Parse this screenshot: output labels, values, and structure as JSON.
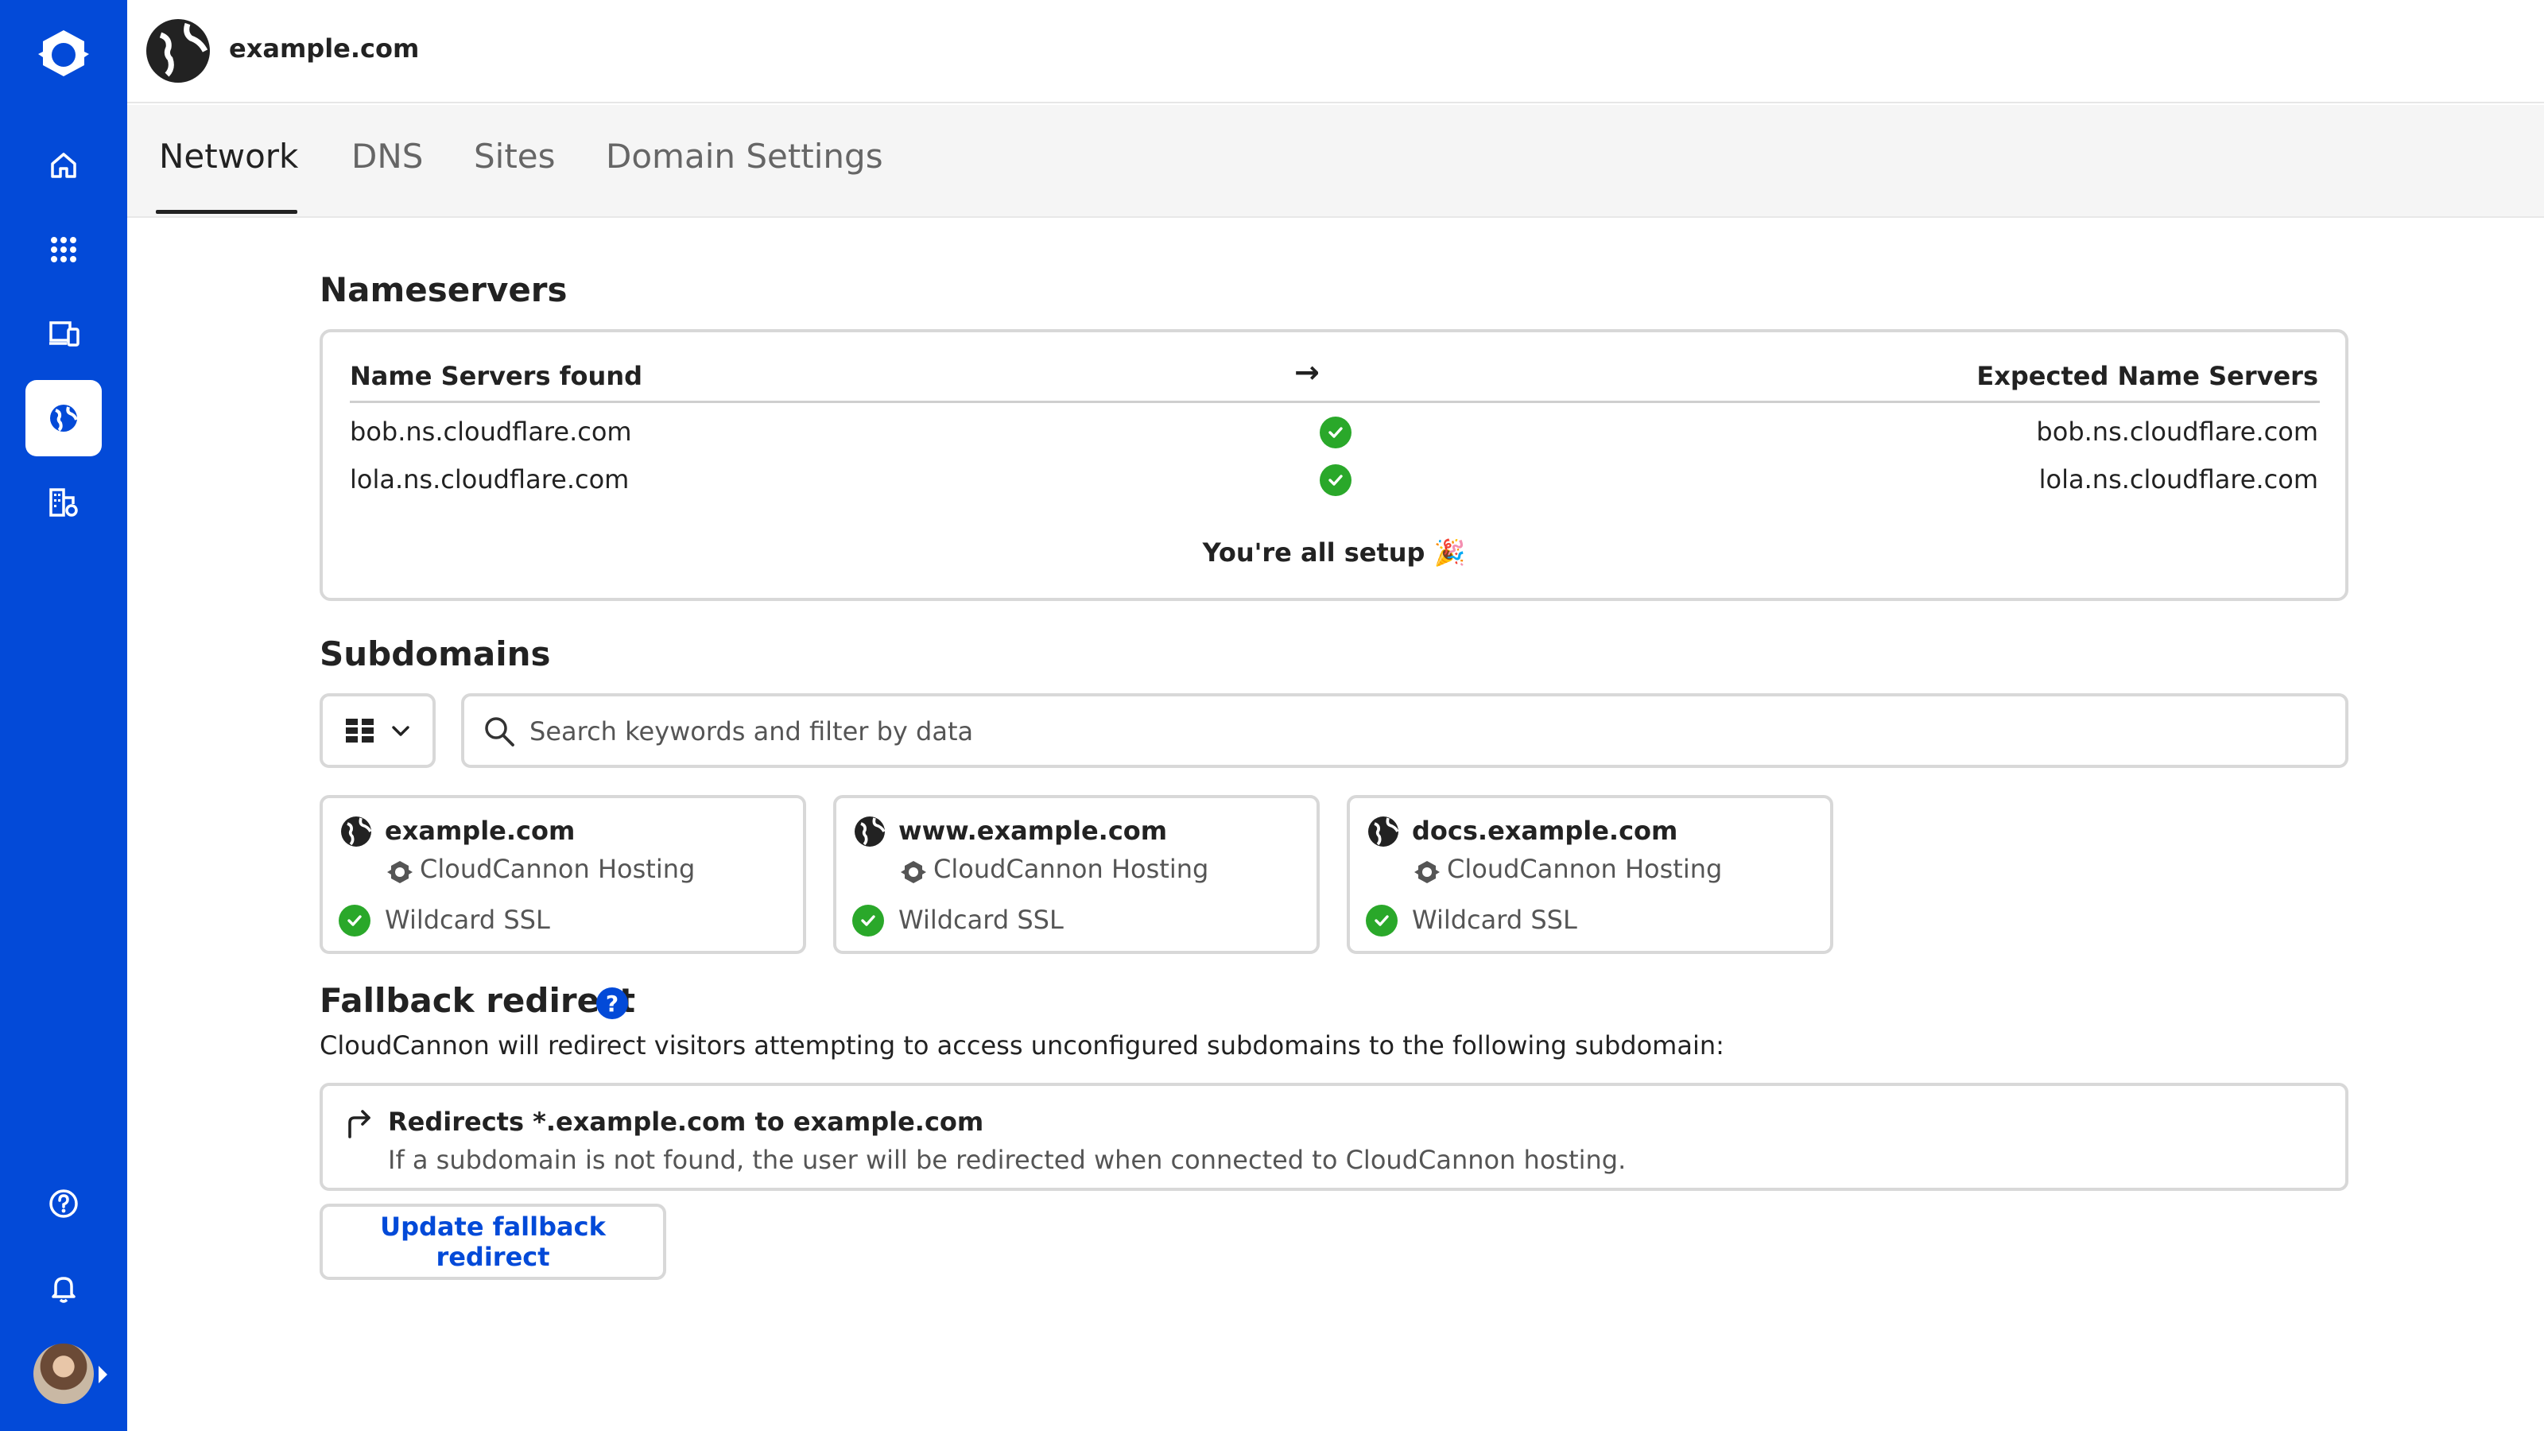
{
  "header": {
    "title": "example.com"
  },
  "tabs": [
    {
      "label": "Network"
    },
    {
      "label": "DNS"
    },
    {
      "label": "Sites"
    },
    {
      "label": "Domain Settings"
    }
  ],
  "nameservers": {
    "title": "Nameservers",
    "found_header": "Name Servers found",
    "expected_header": "Expected Name Servers",
    "arrow": "→",
    "rows": [
      {
        "found": "bob.ns.cloudflare.com",
        "expected": "bob.ns.cloudflare.com"
      },
      {
        "found": "lola.ns.cloudflare.com",
        "expected": "lola.ns.cloudflare.com"
      }
    ],
    "status": "You're all setup 🎉"
  },
  "subdomains": {
    "title": "Subdomains",
    "search_placeholder": "Search keywords and filter by data",
    "cards": [
      {
        "name": "example.com",
        "hosting": "CloudCannon Hosting",
        "ssl": "Wildcard SSL"
      },
      {
        "name": "www.example.com",
        "hosting": "CloudCannon Hosting",
        "ssl": "Wildcard SSL"
      },
      {
        "name": "docs.example.com",
        "hosting": "CloudCannon Hosting",
        "ssl": "Wildcard SSL"
      }
    ]
  },
  "fallback": {
    "title": "Fallback redirect",
    "help": "?",
    "description": "CloudCannon will redirect visitors attempting to access unconfigured subdomains to the following subdomain:",
    "redirect_title": "Redirects *.example.com to example.com",
    "redirect_sub": "If a subdomain is not found, the user will be redirected when connected to CloudCannon hosting.",
    "button": "Update fallback redirect"
  },
  "colors": {
    "brand": "#034ad8",
    "success": "#2aa82a"
  },
  "icons": {
    "sidebar": [
      "cloudcannon-logo-icon",
      "home-icon",
      "apps-grid-icon",
      "devices-icon",
      "globe-icon",
      "buildings-settings-icon",
      "help-circle-icon",
      "bell-icon"
    ]
  }
}
